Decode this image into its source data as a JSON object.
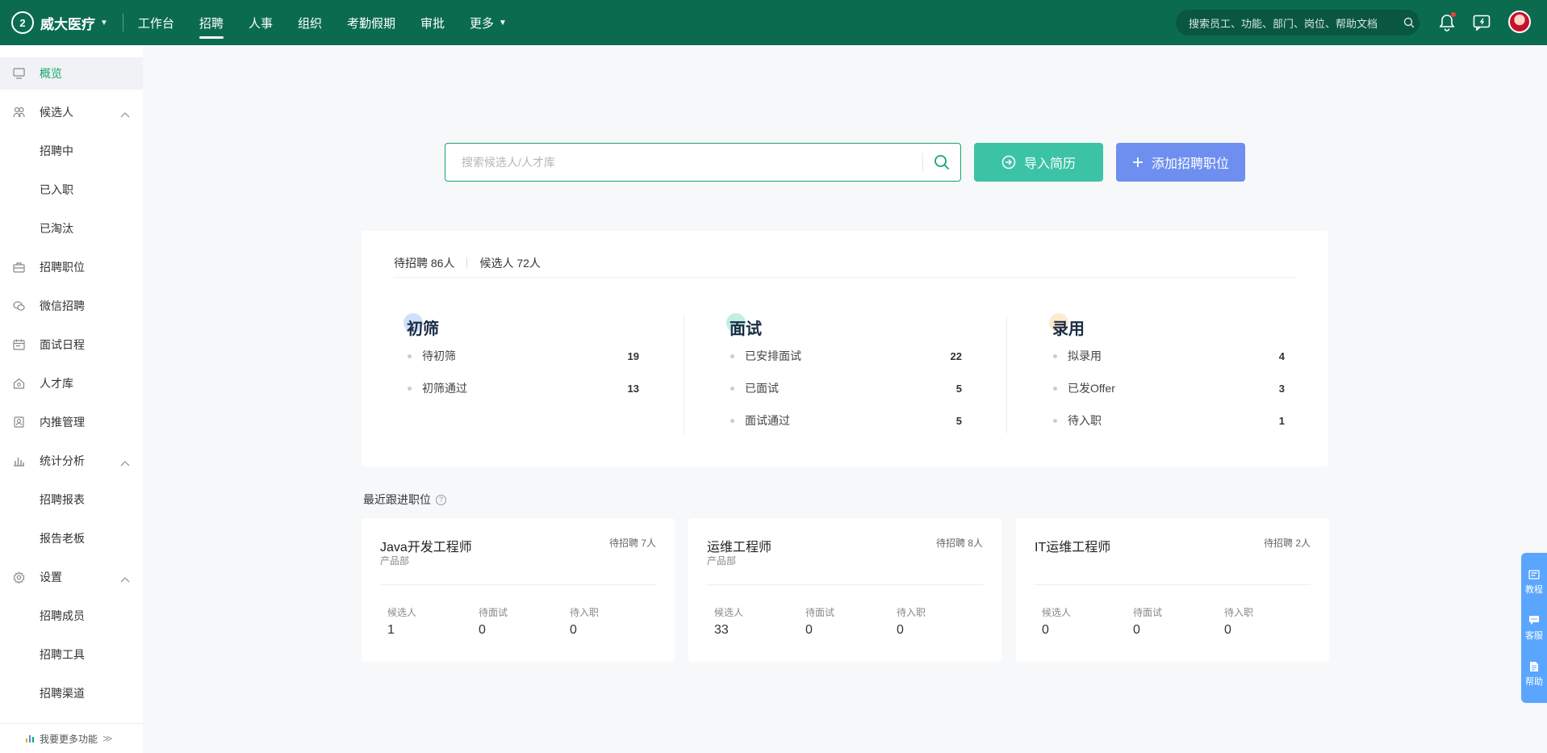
{
  "topbar": {
    "logo_text": "2",
    "company": "威大医疗",
    "nav": [
      "工作台",
      "招聘",
      "人事",
      "组织",
      "考勤假期",
      "审批",
      "更多"
    ],
    "active_nav": "招聘",
    "search_placeholder": "搜索员工、功能、部门、岗位、帮助文档"
  },
  "sidebar": {
    "items": [
      {
        "label": "概览",
        "icon": "monitor-icon",
        "type": "main",
        "active": true
      },
      {
        "label": "候选人",
        "icon": "people-icon",
        "type": "main",
        "expandable": true
      },
      {
        "label": "招聘中",
        "type": "sub"
      },
      {
        "label": "已入职",
        "type": "sub"
      },
      {
        "label": "已淘汰",
        "type": "sub"
      },
      {
        "label": "招聘职位",
        "icon": "briefcase-icon",
        "type": "main"
      },
      {
        "label": "微信招聘",
        "icon": "wechat-icon",
        "type": "main"
      },
      {
        "label": "面试日程",
        "icon": "calendar-icon",
        "type": "main"
      },
      {
        "label": "人才库",
        "icon": "home-icon",
        "type": "main"
      },
      {
        "label": "内推管理",
        "icon": "id-card-icon",
        "type": "main"
      },
      {
        "label": "统计分析",
        "icon": "bar-chart-icon",
        "type": "main",
        "expandable": true
      },
      {
        "label": "招聘报表",
        "type": "sub"
      },
      {
        "label": "报告老板",
        "type": "sub"
      },
      {
        "label": "设置",
        "icon": "gear-icon",
        "type": "main",
        "expandable": true
      },
      {
        "label": "招聘成员",
        "type": "sub"
      },
      {
        "label": "招聘工具",
        "type": "sub"
      },
      {
        "label": "招聘渠道",
        "type": "sub"
      }
    ],
    "footer": "我要更多功能"
  },
  "main": {
    "search_placeholder": "搜索候选人/人才库",
    "import_button": "导入简历",
    "add_button": "添加招聘职位",
    "stats": {
      "pending_hire": "待招聘 86人",
      "candidates": "候选人 72人",
      "stages": [
        {
          "title": "初筛",
          "color": "#a8c8f5",
          "rows": [
            {
              "label": "待初筛",
              "value": "19"
            },
            {
              "label": "初筛通过",
              "value": "13"
            }
          ]
        },
        {
          "title": "面试",
          "color": "#8fe0d0",
          "rows": [
            {
              "label": "已安排面试",
              "value": "22"
            },
            {
              "label": "已面试",
              "value": "5"
            },
            {
              "label": "面试通过",
              "value": "5"
            }
          ]
        },
        {
          "title": "录用",
          "color": "#ffd9a8",
          "rows": [
            {
              "label": "拟录用",
              "value": "4"
            },
            {
              "label": "已发Offer",
              "value": "3"
            },
            {
              "label": "待入职",
              "value": "1"
            }
          ]
        }
      ]
    },
    "recent_title": "最近跟进职位",
    "positions": [
      {
        "title": "Java开发工程师",
        "dept": "产品部",
        "pending": "待招聘 7人",
        "metrics": [
          {
            "label": "候选人",
            "value": "1"
          },
          {
            "label": "待面试",
            "value": "0"
          },
          {
            "label": "待入职",
            "value": "0"
          }
        ]
      },
      {
        "title": "运维工程师",
        "dept": "产品部",
        "pending": "待招聘 8人",
        "metrics": [
          {
            "label": "候选人",
            "value": "33"
          },
          {
            "label": "待面试",
            "value": "0"
          },
          {
            "label": "待入职",
            "value": "0"
          }
        ]
      },
      {
        "title": "IT运维工程师",
        "dept": "",
        "pending": "待招聘 2人",
        "metrics": [
          {
            "label": "候选人",
            "value": "0"
          },
          {
            "label": "待面试",
            "value": "0"
          },
          {
            "label": "待入职",
            "value": "0"
          }
        ]
      }
    ]
  },
  "helper": [
    "教程",
    "客服",
    "帮助"
  ],
  "colors": {
    "topbar": "#0b6b4f",
    "accent": "#13a66b",
    "import": "#3cc3a6",
    "add": "#6e8ff0",
    "helper": "#5aa6ff"
  }
}
